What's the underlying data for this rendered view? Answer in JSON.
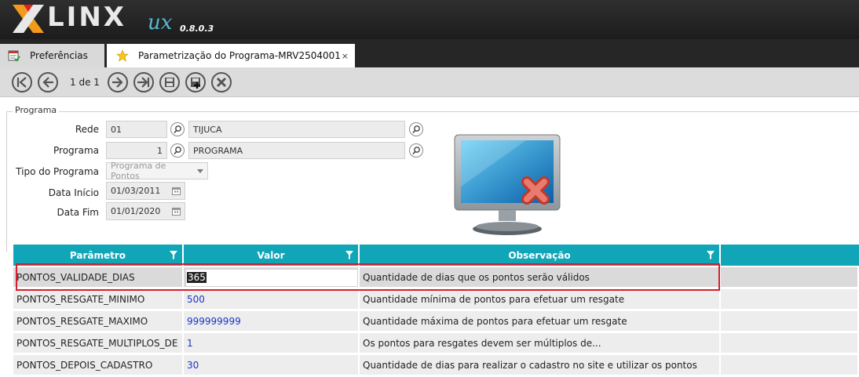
{
  "app": {
    "brand": "LINX",
    "brand_sub": "ux",
    "version": "0.8.0.3"
  },
  "tabs": [
    {
      "label": "Preferências",
      "icon": "preferences-icon"
    },
    {
      "label": "Parametrização do Programa-MRV2504001",
      "icon": "star-icon",
      "close": "×"
    }
  ],
  "toolbar": {
    "pager": "1 de 1",
    "buttons": [
      "first-page-icon",
      "prev-page-icon",
      "next-page-icon",
      "last-page-icon",
      "save-icon",
      "save-new-icon",
      "cancel-icon"
    ]
  },
  "programa": {
    "legend": "Programa",
    "rede_label": "Rede",
    "rede_code": "01",
    "rede_name": "TIJUCA",
    "programa_label": "Programa",
    "programa_code": "1",
    "programa_name": "PROGRAMA",
    "tipo_label": "Tipo do Programa",
    "tipo_placeholder": "Programa de Pontos",
    "data_inicio_label": "Data Início",
    "data_inicio": "01/03/2011",
    "data_fim_label": "Data Fim",
    "data_fim": "01/01/2020"
  },
  "grid": {
    "columns": [
      "Parâmetro",
      "Valor",
      "Observação"
    ],
    "rows": [
      {
        "param": "PONTOS_VALIDADE_DIAS",
        "valor": "365",
        "obs": "Quantidade de dias que os pontos serão válidos"
      },
      {
        "param": "PONTOS_RESGATE_MINIMO",
        "valor": "500",
        "obs": "Quantidade mínima de pontos para efetuar um resgate"
      },
      {
        "param": "PONTOS_RESGATE_MAXIMO",
        "valor": "999999999",
        "obs": "Quantidade máxima de pontos para efetuar um resgate"
      },
      {
        "param": "PONTOS_RESGATE_MULTIPLOS_DE",
        "valor": "1",
        "obs": "Os pontos para resgates devem ser múltiplos de..."
      },
      {
        "param": "PONTOS_DEPOIS_CADASTRO",
        "valor": "30",
        "obs": "Quantidade de dias para realizar o cadastro no site e utilizar os pontos"
      }
    ]
  },
  "colors": {
    "header_bg": "#1c1c1c",
    "grid_header": "#11a5b8",
    "value_text": "#1a35c4",
    "highlight": "#d4202c"
  }
}
